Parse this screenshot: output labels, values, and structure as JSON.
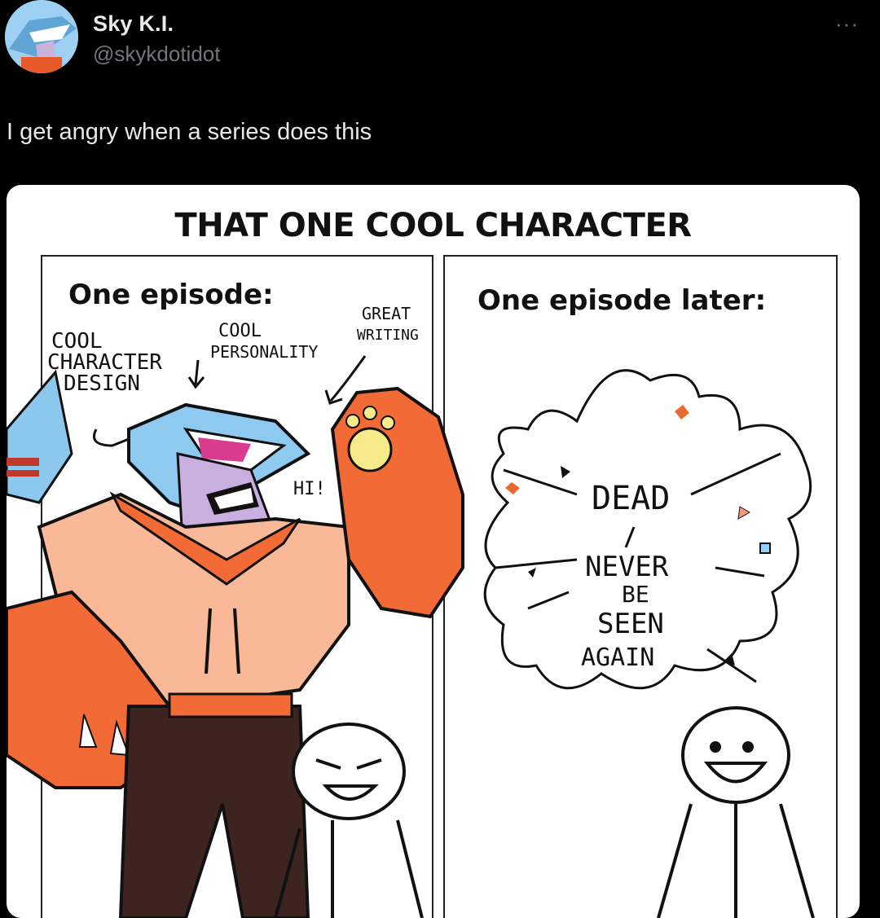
{
  "tweet": {
    "author_name": "Sky K.I.",
    "author_handle": "@skykdotidot",
    "more_icon": "···",
    "text": "I get angry when a series does this"
  },
  "comic": {
    "title": "THAT ONE COOL CHARACTER",
    "left_panel": {
      "heading": "One episode:",
      "notes": {
        "design_1": "COOL",
        "design_2": "CHARACTER",
        "design_3": "DESIGN",
        "personality_1": "COOL",
        "personality_2": "PERSONALITY",
        "writing_1": "GREAT",
        "writing_2": "WRITING",
        "greeting": "HI!"
      }
    },
    "right_panel": {
      "heading": "One episode later:",
      "words": {
        "dead": "DEAD",
        "never": "NEVER",
        "be": "BE",
        "seen": "SEEN",
        "again": "AGAIN"
      }
    }
  },
  "colors": {
    "background": "#000000",
    "text_primary": "#e7e9ea",
    "text_secondary": "#71767b",
    "shark_orange": "#f26a35",
    "shirt_peach": "#f9b897"
  }
}
